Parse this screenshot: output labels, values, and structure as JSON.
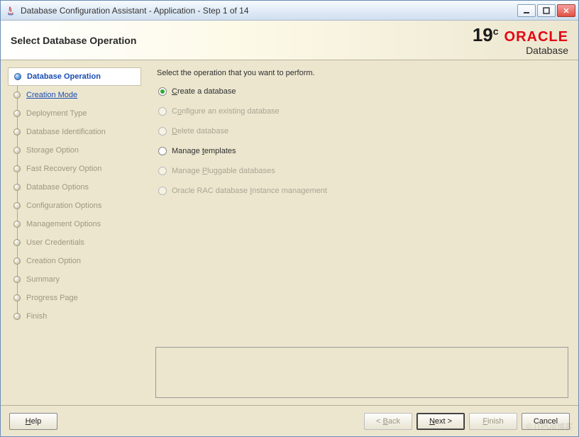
{
  "window": {
    "title": "Database Configuration Assistant - Application - Step 1 of 14"
  },
  "header": {
    "heading": "Select Database Operation",
    "version": "19",
    "version_suffix": "c",
    "brand": "ORACLE",
    "product": "Database"
  },
  "sidebar": {
    "steps": [
      {
        "label": "Database Operation",
        "state": "active"
      },
      {
        "label": "Creation Mode",
        "state": "link"
      },
      {
        "label": "Deployment Type",
        "state": "disabled"
      },
      {
        "label": "Database Identification",
        "state": "disabled"
      },
      {
        "label": "Storage Option",
        "state": "disabled"
      },
      {
        "label": "Fast Recovery Option",
        "state": "disabled"
      },
      {
        "label": "Database Options",
        "state": "disabled"
      },
      {
        "label": "Configuration Options",
        "state": "disabled"
      },
      {
        "label": "Management Options",
        "state": "disabled"
      },
      {
        "label": "User Credentials",
        "state": "disabled"
      },
      {
        "label": "Creation Option",
        "state": "disabled"
      },
      {
        "label": "Summary",
        "state": "disabled"
      },
      {
        "label": "Progress Page",
        "state": "disabled"
      },
      {
        "label": "Finish",
        "state": "disabled"
      }
    ]
  },
  "main": {
    "prompt": "Select the operation that you want to perform.",
    "options": [
      {
        "pre": "",
        "mn": "C",
        "post": "reate a database",
        "enabled": true,
        "checked": true
      },
      {
        "pre": "C",
        "mn": "o",
        "post": "nfigure an existing database",
        "enabled": false,
        "checked": false
      },
      {
        "pre": "",
        "mn": "D",
        "post": "elete database",
        "enabled": false,
        "checked": false
      },
      {
        "pre": "Manage ",
        "mn": "t",
        "post": "emplates",
        "enabled": true,
        "checked": false
      },
      {
        "pre": "Manage ",
        "mn": "P",
        "post": "luggable databases",
        "enabled": false,
        "checked": false
      },
      {
        "pre": "Oracle RAC database ",
        "mn": "I",
        "post": "nstance management",
        "enabled": false,
        "checked": false
      }
    ]
  },
  "footer": {
    "help": {
      "mn": "H",
      "post": "elp"
    },
    "back": {
      "pre": "< ",
      "mn": "B",
      "post": "ack"
    },
    "next": {
      "mn": "N",
      "post": "ext >"
    },
    "finish": {
      "mn": "F",
      "post": "inish"
    },
    "cancel": {
      "label": "Cancel"
    }
  },
  "watermark": "© ITPUB博客"
}
